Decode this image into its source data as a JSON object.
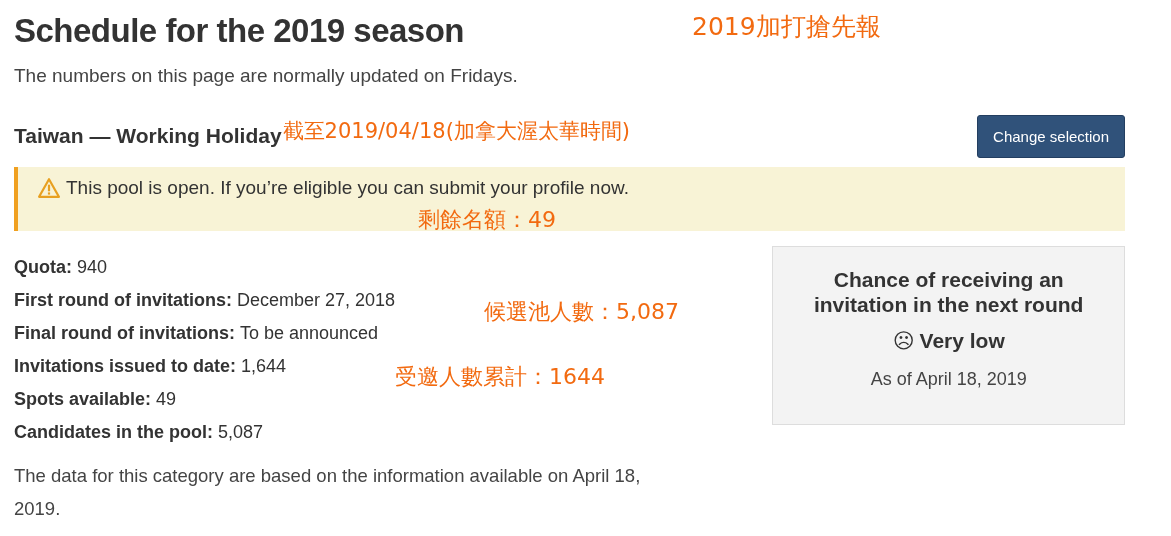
{
  "title": "Schedule for the 2019 season",
  "subtitle": "The numbers on this page are normally updated on Fridays.",
  "category": "Taiwan — Working Holiday",
  "change_button": "Change selection",
  "alert": {
    "kind": "warning",
    "text": "This pool is open. If you’re eligible you can submit your profile now."
  },
  "facts": [
    {
      "label": "Quota:",
      "value": "940"
    },
    {
      "label": "First round of invitations:",
      "value": "December 27, 2018"
    },
    {
      "label": "Final round of invitations:",
      "value": "To be announced"
    },
    {
      "label": "Invitations issued to date:",
      "value": "1,644"
    },
    {
      "label": "Spots available:",
      "value": "49"
    },
    {
      "label": "Candidates in the pool:",
      "value": "5,087"
    }
  ],
  "note": "The data for this category are based on the information available on April 18, 2019.",
  "chance_card": {
    "heading": "Chance of receiving an invitation in the next round",
    "icon": "☹",
    "rating": "Very low",
    "date": "As of April 18, 2019"
  },
  "annotations": {
    "headline": "2019加打搶先報",
    "as_of": "截至2019/04/18(加拿大渥太華時間)",
    "remaining": "剩餘名額：49",
    "pool": "候選池人數：5,087",
    "invited": "受邀人數累計：1644"
  }
}
